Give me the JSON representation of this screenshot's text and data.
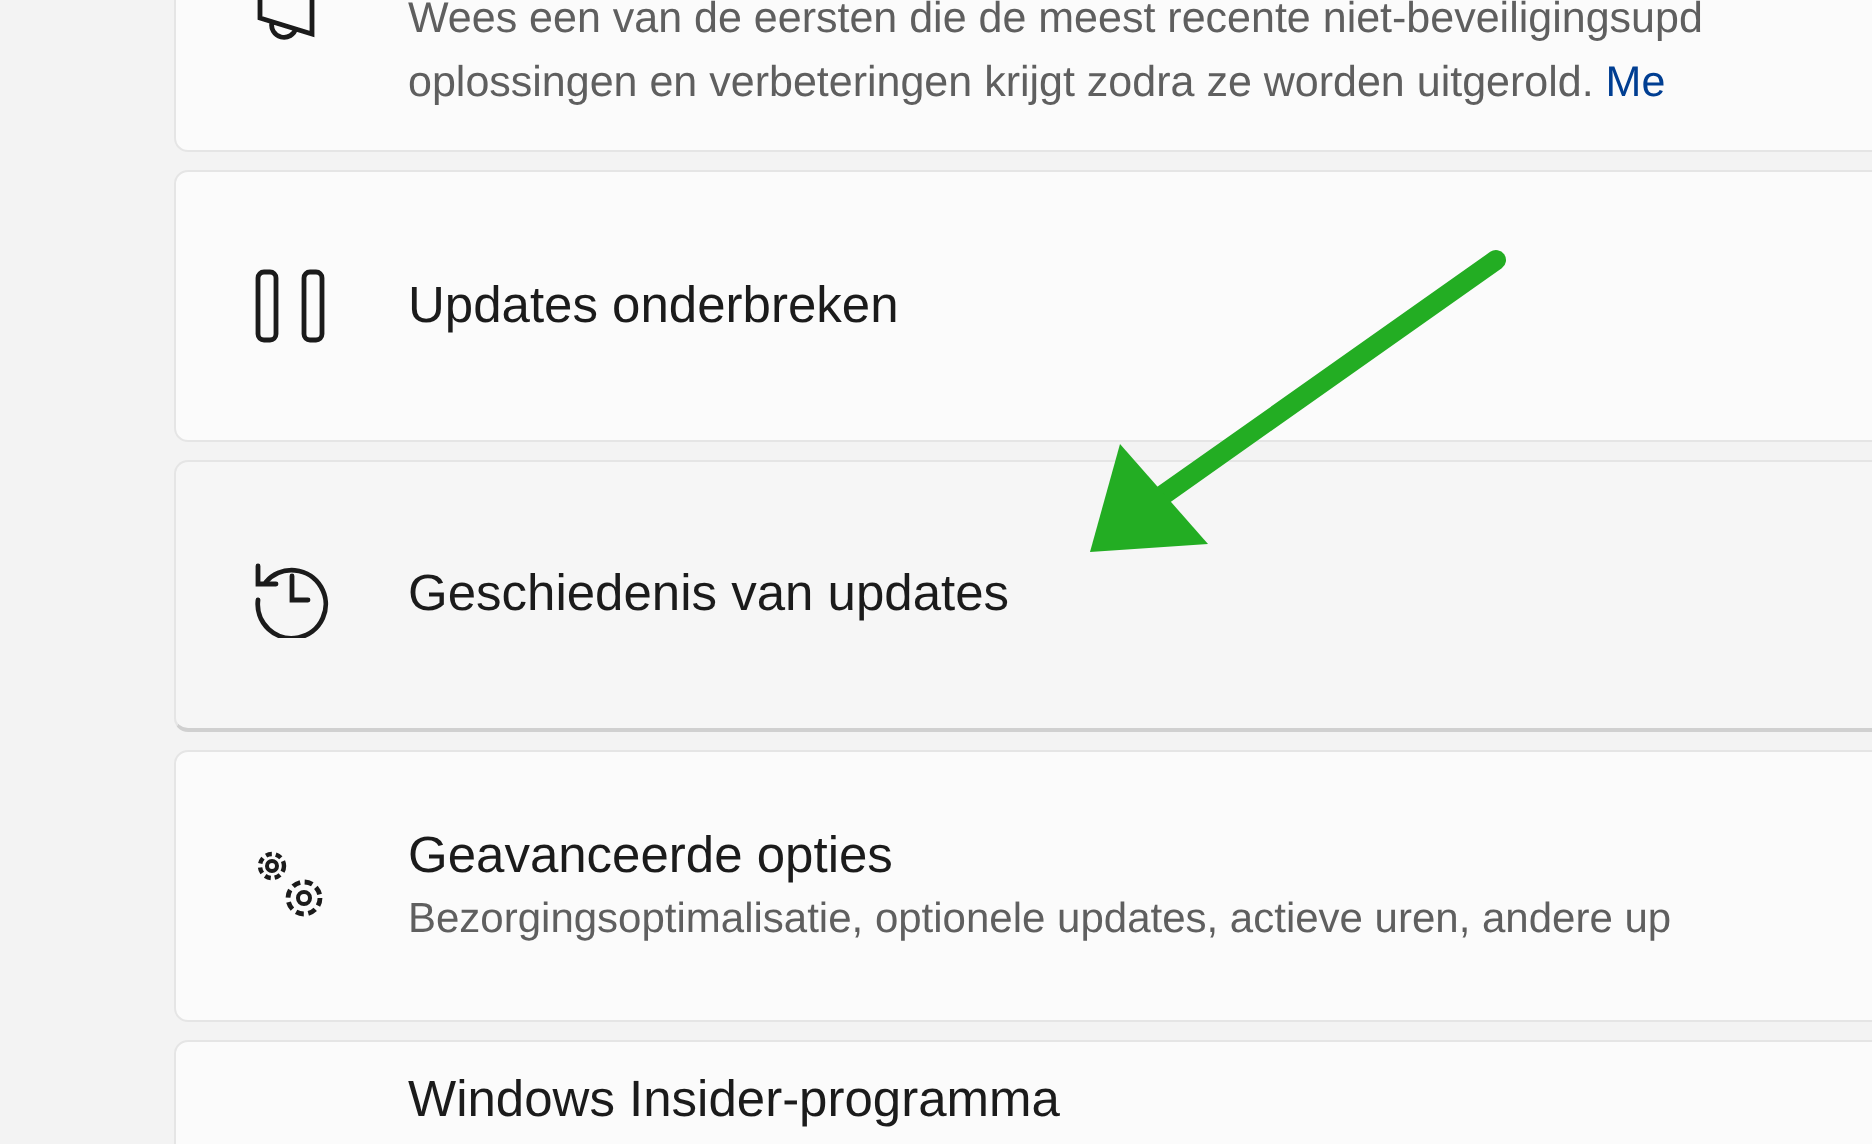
{
  "cards": [
    {
      "kind": "description",
      "lines": [
        "Wees een van de eersten die de meest recente niet-beveiligingsupd",
        "oplossingen en verbeteringen krijgt zodra ze worden uitgerold."
      ],
      "link": "Me",
      "hovered": false
    },
    {
      "kind": "item",
      "title": "Updates onderbreken",
      "hovered": false
    },
    {
      "kind": "item",
      "title": "Geschiedenis van updates",
      "hovered": true
    },
    {
      "kind": "item",
      "title": "Geavanceerde opties",
      "subtitle": "Bezorgingsoptimalisatie, optionele updates, actieve uren, andere up",
      "hovered": false
    },
    {
      "kind": "item",
      "title": "Windows Insider-programma"
    }
  ]
}
